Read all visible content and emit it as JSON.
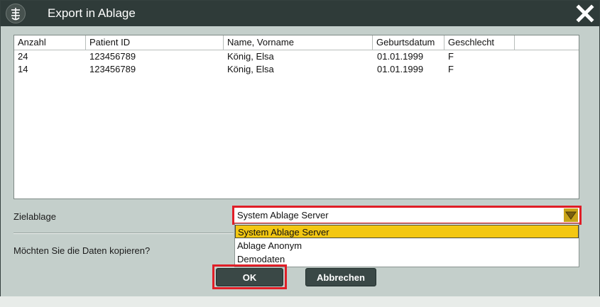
{
  "dialog": {
    "title": "Export in Ablage",
    "icons": {
      "app": "dicom-tree-icon",
      "close": "close-icon"
    }
  },
  "table": {
    "columns": [
      "Anzahl",
      "Patient ID",
      "Name, Vorname",
      "Geburtsdatum",
      "Geschlecht"
    ],
    "rows": [
      [
        "24",
        "123456789",
        "König, Elsa",
        "01.01.1999",
        "F"
      ],
      [
        "14",
        "123456789",
        "König, Elsa",
        "01.01.1999",
        "F"
      ]
    ]
  },
  "target": {
    "label": "Zielablage",
    "selected": "System Ablage Server",
    "options": [
      "System Ablage Server",
      "Ablage Anonym",
      "Demodaten"
    ],
    "highlighted_index": 0
  },
  "question": "Möchten Sie die Daten kopieren?",
  "buttons": {
    "ok": "OK",
    "cancel": "Abbrechen"
  },
  "colors": {
    "titlebar": "#2f3b39",
    "highlight": "#f3c712",
    "annotation": "#e01e27"
  }
}
